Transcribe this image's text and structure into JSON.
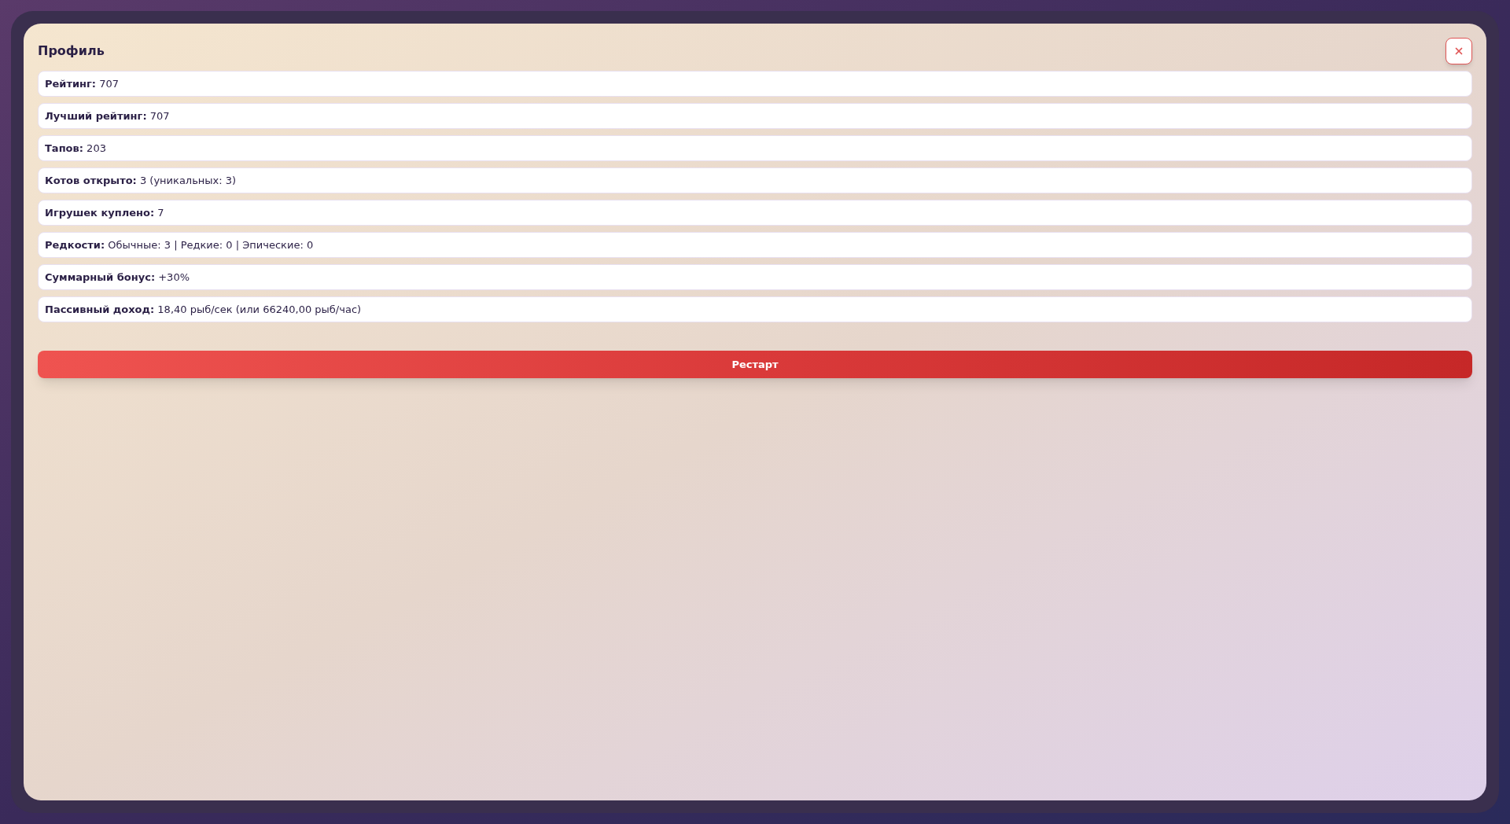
{
  "dialog": {
    "title": "Профиль",
    "stats": [
      {
        "text": "**Рейтинг:** 707"
      },
      {
        "text": "**Лучший рейтинг:** 707"
      },
      {
        "text": "**Тапов:** 203"
      },
      {
        "text": "**Котов открыто:** 3 (уникальных: 3)"
      },
      {
        "text": "**Игрушек куплено:** 7"
      },
      {
        "text": "**Редкости:** Обычные: 3 | Редкие: 0 | Эпические: 0"
      },
      {
        "text": "**Суммарный бонус:** +30%"
      },
      {
        "text": "**Пассивный доход:** 18,40 рыб/сек (или 66240,00 рыб/час)"
      }
    ],
    "restart_button": "Рестарт"
  }
}
